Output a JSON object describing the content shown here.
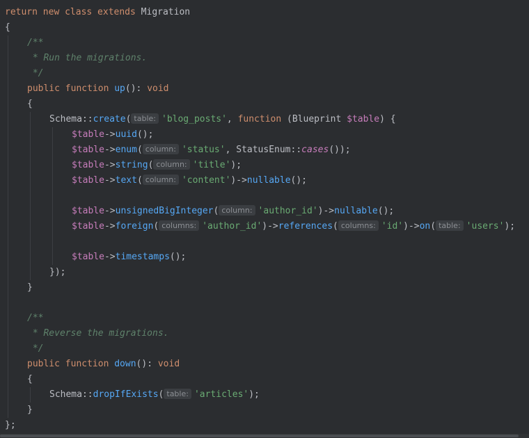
{
  "editor": {
    "colors": {
      "background": "#2b2d30",
      "default": "#bcbec4",
      "keyword": "#cf8e6d",
      "method": "#56a8f5",
      "call": "#56a8f5",
      "variable": "#c77dbb",
      "string": "#6aab73",
      "comment": "#7a7e85",
      "doc": "#5f826b",
      "hint_bg": "#3b3e42",
      "hint_fg": "#8c8f94"
    },
    "lines": [
      {
        "indent": 0,
        "tokens": [
          {
            "t": "return new class extends ",
            "c": "keyword"
          },
          {
            "t": "Migration",
            "c": "default"
          }
        ]
      },
      {
        "indent": 0,
        "tokens": [
          {
            "t": "{",
            "c": "default"
          }
        ]
      },
      {
        "indent": 1,
        "tokens": [
          {
            "t": "/**",
            "c": "doc"
          }
        ]
      },
      {
        "indent": 1,
        "tokens": [
          {
            "t": " * Run the migrations.",
            "c": "doc"
          }
        ]
      },
      {
        "indent": 1,
        "tokens": [
          {
            "t": " */",
            "c": "doc"
          }
        ]
      },
      {
        "indent": 1,
        "tokens": [
          {
            "t": "public function ",
            "c": "keyword"
          },
          {
            "t": "up",
            "c": "fn"
          },
          {
            "t": "(): ",
            "c": "default"
          },
          {
            "t": "void",
            "c": "keyword"
          }
        ]
      },
      {
        "indent": 1,
        "tokens": [
          {
            "t": "{",
            "c": "default"
          }
        ]
      },
      {
        "indent": 2,
        "tokens": [
          {
            "t": "Schema",
            "c": "default"
          },
          {
            "t": "::",
            "c": "default"
          },
          {
            "t": "create",
            "c": "call"
          },
          {
            "t": "(",
            "c": "default"
          },
          {
            "hint": "table:"
          },
          {
            "t": "'blog_posts'",
            "c": "string"
          },
          {
            "t": ", ",
            "c": "default"
          },
          {
            "t": "function ",
            "c": "keyword"
          },
          {
            "t": "(Blueprint ",
            "c": "default"
          },
          {
            "t": "$table",
            "c": "variable"
          },
          {
            "t": ") {",
            "c": "default"
          }
        ]
      },
      {
        "indent": 3,
        "tokens": [
          {
            "t": "$table",
            "c": "variable"
          },
          {
            "t": "->",
            "c": "default"
          },
          {
            "t": "uuid",
            "c": "call"
          },
          {
            "t": "();",
            "c": "default"
          }
        ]
      },
      {
        "indent": 3,
        "tokens": [
          {
            "t": "$table",
            "c": "variable"
          },
          {
            "t": "->",
            "c": "default"
          },
          {
            "t": "enum",
            "c": "call"
          },
          {
            "t": "(",
            "c": "default"
          },
          {
            "hint": "column:"
          },
          {
            "t": "'status'",
            "c": "string"
          },
          {
            "t": ", StatusEnum::",
            "c": "default"
          },
          {
            "t": "cases",
            "c": "static"
          },
          {
            "t": "());",
            "c": "default"
          }
        ]
      },
      {
        "indent": 3,
        "tokens": [
          {
            "t": "$table",
            "c": "variable"
          },
          {
            "t": "->",
            "c": "default"
          },
          {
            "t": "string",
            "c": "call"
          },
          {
            "t": "(",
            "c": "default"
          },
          {
            "hint": "column:"
          },
          {
            "t": "'title'",
            "c": "string"
          },
          {
            "t": ");",
            "c": "default"
          }
        ]
      },
      {
        "indent": 3,
        "tokens": [
          {
            "t": "$table",
            "c": "variable"
          },
          {
            "t": "->",
            "c": "default"
          },
          {
            "t": "text",
            "c": "call"
          },
          {
            "t": "(",
            "c": "default"
          },
          {
            "hint": "column:"
          },
          {
            "t": "'content'",
            "c": "string"
          },
          {
            "t": ")->",
            "c": "default"
          },
          {
            "t": "nullable",
            "c": "call"
          },
          {
            "t": "();",
            "c": "default"
          }
        ]
      },
      {
        "indent": 3,
        "tokens": []
      },
      {
        "indent": 3,
        "tokens": [
          {
            "t": "$table",
            "c": "variable"
          },
          {
            "t": "->",
            "c": "default"
          },
          {
            "t": "unsignedBigInteger",
            "c": "call"
          },
          {
            "t": "(",
            "c": "default"
          },
          {
            "hint": "column:"
          },
          {
            "t": "'author_id'",
            "c": "string"
          },
          {
            "t": ")->",
            "c": "default"
          },
          {
            "t": "nullable",
            "c": "call"
          },
          {
            "t": "();",
            "c": "default"
          }
        ]
      },
      {
        "indent": 3,
        "tokens": [
          {
            "t": "$table",
            "c": "variable"
          },
          {
            "t": "->",
            "c": "default"
          },
          {
            "t": "foreign",
            "c": "call"
          },
          {
            "t": "(",
            "c": "default"
          },
          {
            "hint": "columns:"
          },
          {
            "t": "'author_id'",
            "c": "string"
          },
          {
            "t": ")->",
            "c": "default"
          },
          {
            "t": "references",
            "c": "call"
          },
          {
            "t": "(",
            "c": "default"
          },
          {
            "hint": "columns:"
          },
          {
            "t": "'id'",
            "c": "string"
          },
          {
            "t": ")->",
            "c": "default"
          },
          {
            "t": "on",
            "c": "call"
          },
          {
            "t": "(",
            "c": "default"
          },
          {
            "hint": "table:"
          },
          {
            "t": "'users'",
            "c": "string"
          },
          {
            "t": ");",
            "c": "default"
          }
        ]
      },
      {
        "indent": 3,
        "tokens": []
      },
      {
        "indent": 3,
        "tokens": [
          {
            "t": "$table",
            "c": "variable"
          },
          {
            "t": "->",
            "c": "default"
          },
          {
            "t": "timestamps",
            "c": "call"
          },
          {
            "t": "();",
            "c": "default"
          }
        ]
      },
      {
        "indent": 2,
        "tokens": [
          {
            "t": "});",
            "c": "default"
          }
        ]
      },
      {
        "indent": 1,
        "tokens": [
          {
            "t": "}",
            "c": "default"
          }
        ]
      },
      {
        "indent": 1,
        "tokens": []
      },
      {
        "indent": 1,
        "tokens": [
          {
            "t": "/**",
            "c": "doc"
          }
        ]
      },
      {
        "indent": 1,
        "tokens": [
          {
            "t": " * Reverse the migrations.",
            "c": "doc"
          }
        ]
      },
      {
        "indent": 1,
        "tokens": [
          {
            "t": " */",
            "c": "doc"
          }
        ]
      },
      {
        "indent": 1,
        "tokens": [
          {
            "t": "public function ",
            "c": "keyword"
          },
          {
            "t": "down",
            "c": "fn"
          },
          {
            "t": "(): ",
            "c": "default"
          },
          {
            "t": "void",
            "c": "keyword"
          }
        ]
      },
      {
        "indent": 1,
        "tokens": [
          {
            "t": "{",
            "c": "default"
          }
        ]
      },
      {
        "indent": 2,
        "tokens": [
          {
            "t": "Schema",
            "c": "default"
          },
          {
            "t": "::",
            "c": "default"
          },
          {
            "t": "dropIfExists",
            "c": "call"
          },
          {
            "t": "(",
            "c": "default"
          },
          {
            "hint": "table:"
          },
          {
            "t": "'articles'",
            "c": "string"
          },
          {
            "t": ");",
            "c": "default"
          }
        ]
      },
      {
        "indent": 1,
        "tokens": [
          {
            "t": "}",
            "c": "default"
          }
        ]
      },
      {
        "indent": 0,
        "tokens": [
          {
            "t": "};",
            "c": "default"
          }
        ]
      }
    ]
  }
}
